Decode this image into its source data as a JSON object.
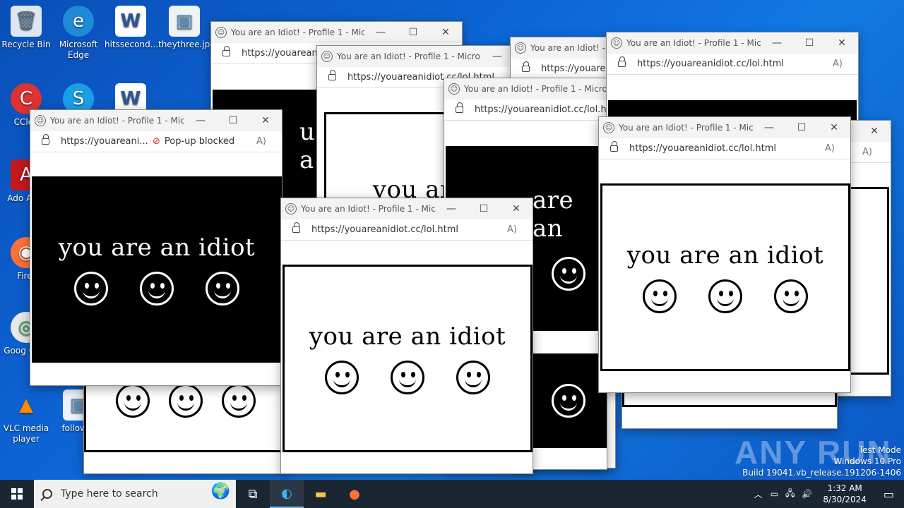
{
  "desktop": {
    "icons": [
      {
        "label": "Recycle Bin",
        "glyph": "🗑"
      },
      {
        "label": "Microsoft Edge",
        "glyph": "e"
      },
      {
        "label": "hitssecond...",
        "glyph": "W"
      },
      {
        "label": "theythree.jpg",
        "glyph": "▣"
      },
      {
        "label": "CClea",
        "glyph": "C"
      },
      {
        "label": "",
        "glyph": "S"
      },
      {
        "label": "",
        "glyph": "W"
      },
      {
        "label": "Ado Acro",
        "glyph": "A"
      },
      {
        "label": "Firef",
        "glyph": "◉"
      },
      {
        "label": "Goog Chro",
        "glyph": "◎"
      },
      {
        "label": "VLC media player",
        "glyph": "▲"
      },
      {
        "label": "followm",
        "glyph": "▣"
      }
    ]
  },
  "window": {
    "title": "You are an Idiot! - Profile 1 - Micro...",
    "url_full": "https://youareanidiot.cc/lol.html",
    "url_trunc_1": "https://youarean",
    "url_trunc_2": "https://youareanidiot.cc/lol.html",
    "url_trunc_3": "https://youare",
    "url_trunc_4": "https://youareanidiot.cc/lol.ht",
    "url_trunc_5": "https://youareani...",
    "popup_blocked": "Pop-up blocked",
    "minimize": "—",
    "maximize": "☐",
    "close": "✕",
    "read_aloud": "A)",
    "message": "you are an idiot",
    "fragment_1": "u a",
    "fragment_2": "you are",
    "fragment_3": "are an"
  },
  "taskbar": {
    "search_placeholder": "Type here to search",
    "time": "1:32 AM",
    "date": "8/30/2024"
  },
  "watermark": {
    "line1": "Test Mode",
    "line2": "Windows 10 Pro",
    "line3": "Build 19041.vb_release.191206-1406",
    "brand": "ANY RUN"
  }
}
